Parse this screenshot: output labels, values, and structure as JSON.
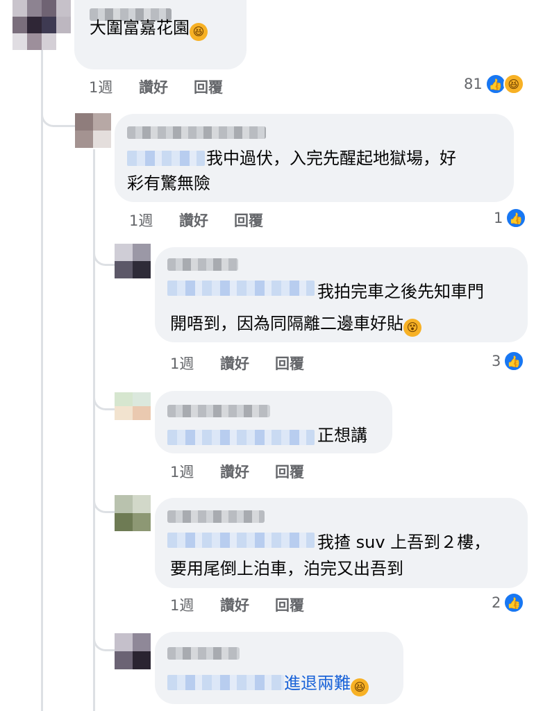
{
  "comments": [
    {
      "text": "大圍富嘉花園",
      "emoji": "laughing-emoji",
      "actions": {
        "time": "1週",
        "like": "讚好",
        "reply": "回覆"
      },
      "reaction_count": "81",
      "reaction_icons": [
        "like-icon",
        "haha-icon"
      ]
    },
    {
      "line1": "我中過伏，入完先醒起地獄場，好",
      "line2": "彩有驚無險",
      "actions": {
        "time": "1週",
        "like": "讚好",
        "reply": "回覆"
      },
      "reaction_count": "1",
      "reaction_icons": [
        "like-icon"
      ]
    },
    {
      "line1": "我拍完車之後先知車門",
      "line2": "開唔到，因為同隔離二邊車好貼",
      "emoji": "dizzy-face-emoji",
      "actions": {
        "time": "1週",
        "like": "讚好",
        "reply": "回覆"
      },
      "reaction_count": "3",
      "reaction_icons": [
        "like-icon"
      ]
    },
    {
      "line1": "正想講",
      "actions": {
        "time": "1週",
        "like": "讚好",
        "reply": "回覆"
      }
    },
    {
      "line1": "我揸 suv 上吾到２樓，",
      "line2": "要用尾倒上泊車，泊完又出吾到",
      "actions": {
        "time": "1週",
        "like": "讚好",
        "reply": "回覆"
      },
      "reaction_count": "2",
      "reaction_icons": [
        "like-icon"
      ]
    },
    {
      "line1": "進退兩難",
      "emoji": "laughing-emoji"
    }
  ],
  "colors": {
    "bubble": "#f0f2f5",
    "secondary_text": "#65676b",
    "like_blue": "#1877f2",
    "link_blue": "#1a63d8",
    "thread_line": "#dde0e4"
  }
}
